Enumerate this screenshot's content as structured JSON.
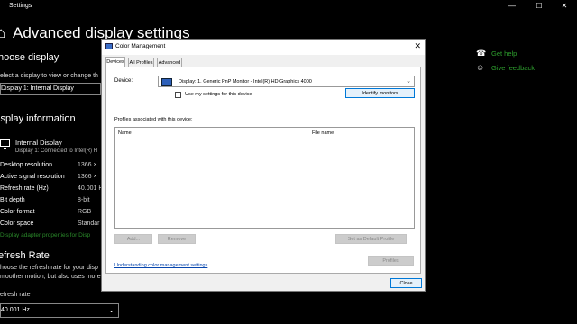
{
  "settings": {
    "app_title": "Settings",
    "page_title": "Advanced display settings",
    "choose_display": {
      "heading": "hoose display",
      "description": "elect a display to view or change th",
      "selected": "Display 1: Internal Display"
    },
    "display_info": {
      "heading": "isplay information",
      "display_name": "Internal Display",
      "display_sub": "Display 1: Connected to Intel(R) H",
      "rows": [
        {
          "label": "Desktop resolution",
          "value": "1366 ×"
        },
        {
          "label": "Active signal resolution",
          "value": "1366 ×"
        },
        {
          "label": "Refresh rate (Hz)",
          "value": "40.001 H"
        },
        {
          "label": "Bit depth",
          "value": "8-bit"
        },
        {
          "label": "Color format",
          "value": "RGB"
        },
        {
          "label": "Color space",
          "value": "Standar"
        }
      ],
      "adapter_link": "Display adapter properties for Disp"
    },
    "refresh_rate": {
      "heading": "efresh Rate",
      "desc1": "hoose the refresh rate for your disp",
      "desc2": "moother motion, but also uses more",
      "label": "efresh rate",
      "selected": "40.001 Hz"
    },
    "side_links": {
      "help": "Get help",
      "feedback": "Give feedback"
    }
  },
  "dialog": {
    "title": "Color Management",
    "tabs": [
      "Devices",
      "All Profiles",
      "Advanced"
    ],
    "device_label": "Device:",
    "device_value": "Display: 1. Generic PnP Monitor - Intel(R) HD Graphics 4000",
    "checkbox_label": "Use my settings for this device",
    "identify_button": "Identify monitors",
    "profiles_label": "Profiles associated with this device:",
    "columns": [
      "Name",
      "File name"
    ],
    "buttons": {
      "add": "Add...",
      "remove": "Remove",
      "set_default": "Set as Default Profile",
      "profiles": "Profiles",
      "close": "Close"
    },
    "understanding_link": "Understanding color management settings"
  }
}
